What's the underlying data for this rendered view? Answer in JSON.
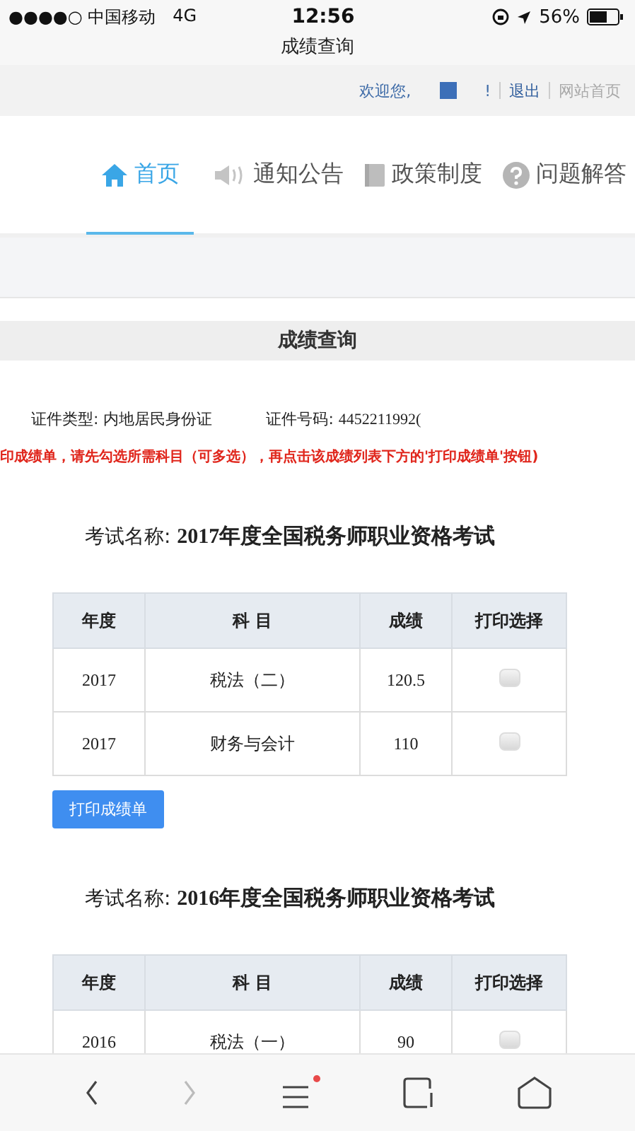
{
  "status_bar": {
    "carrier": "●●●●○ 中国移动",
    "network": "4G",
    "time": "12:56",
    "battery": "56%"
  },
  "window": {
    "title": "成绩查询"
  },
  "top_bar": {
    "welcome": "欢迎您,",
    "welcome_end": "!",
    "logout": "退出",
    "home_link": "网站首页"
  },
  "tabs": [
    {
      "label": "首页",
      "selected": true
    },
    {
      "label": "通知公告",
      "selected": false
    },
    {
      "label": "政策制度",
      "selected": false
    },
    {
      "label": "问题解答",
      "selected": false
    }
  ],
  "section_title": "成绩查询",
  "id_info": {
    "type_label": "证件类型:",
    "type_value": "内地居民身份证",
    "number_label": "证件号码:",
    "number_value": "4452211992("
  },
  "notice": "印成绩单，请先勾选所需科目（可多选），再点击该成绩列表下方的'打印成绩单'按钮)",
  "exams": [
    {
      "label": "考试名称:",
      "name": "2017年度全国税务师职业资格考试",
      "columns": [
        "年度",
        "科 目",
        "成绩",
        "打印选择"
      ],
      "rows": [
        {
          "year": "2017",
          "subject": "税法（二）",
          "score": "120.5",
          "selected": false
        },
        {
          "year": "2017",
          "subject": "财务与会计",
          "score": "110",
          "selected": false
        }
      ],
      "button": "打印成绩单"
    },
    {
      "label": "考试名称:",
      "name": "2016年度全国税务师职业资格考试",
      "columns": [
        "年度",
        "科 目",
        "成绩",
        "打印选择"
      ],
      "rows": [
        {
          "year": "2016",
          "subject": "税法（一）",
          "score": "90",
          "selected": false
        }
      ]
    }
  ]
}
